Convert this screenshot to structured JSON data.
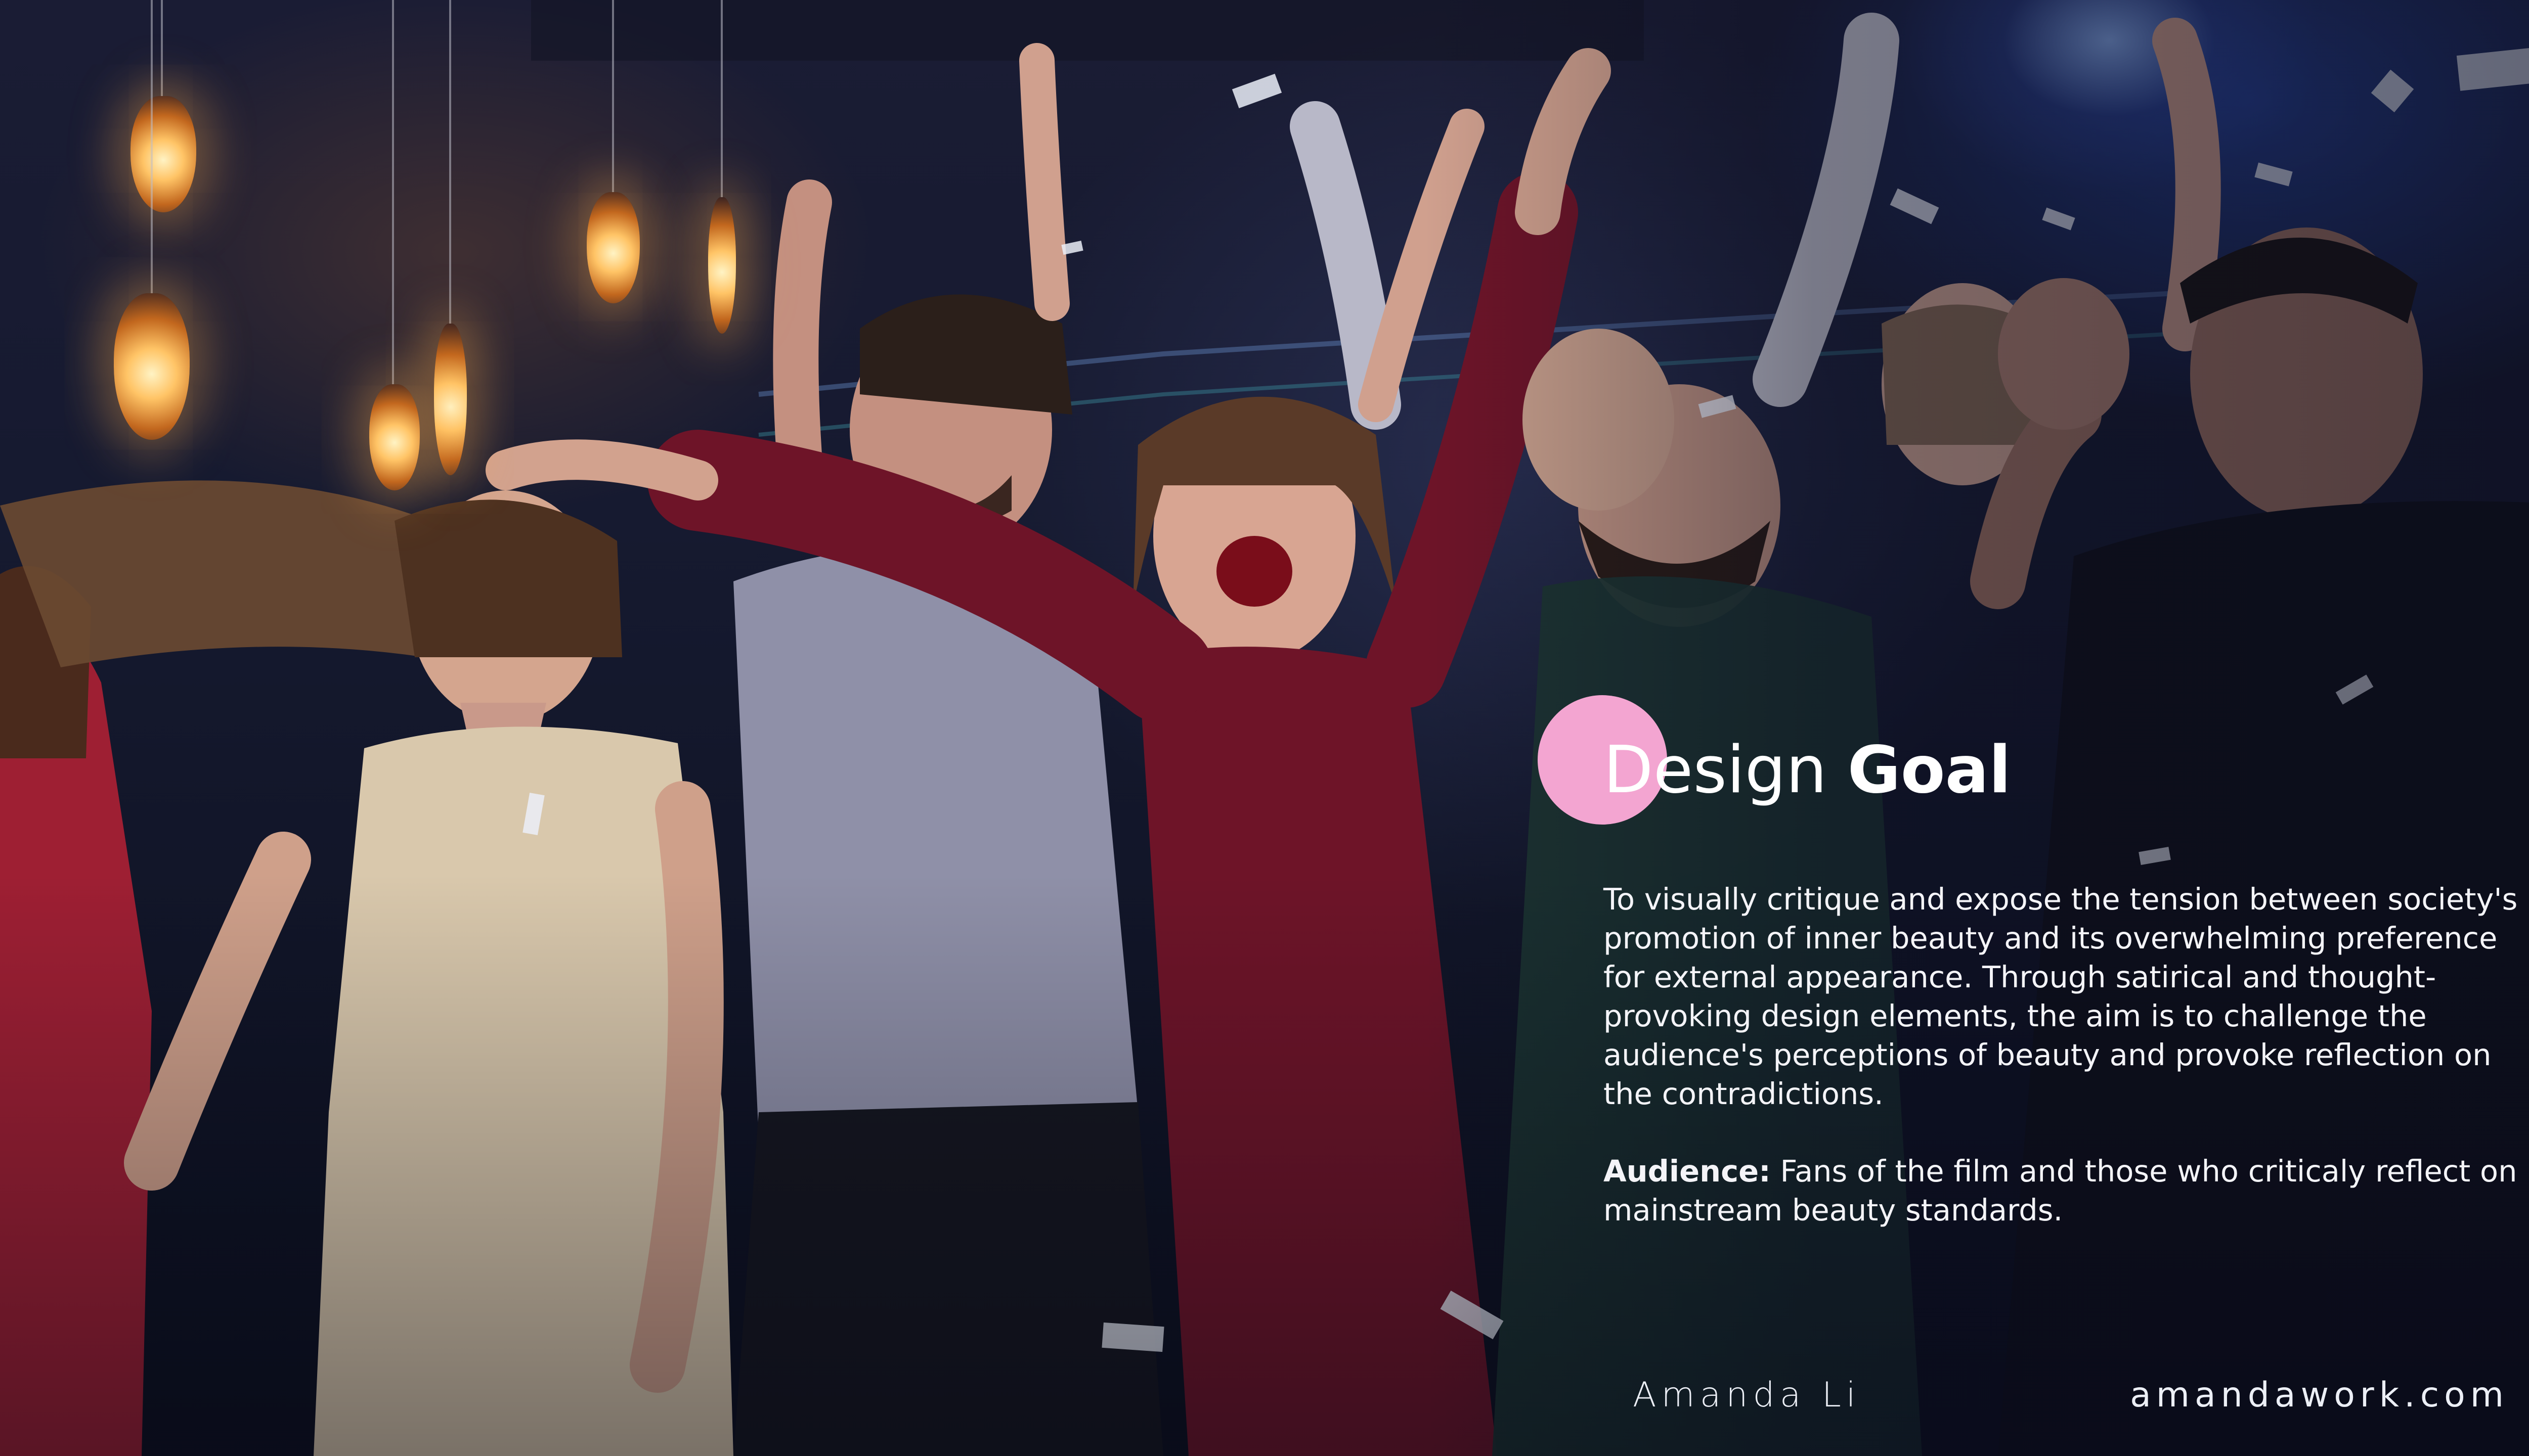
{
  "slide": {
    "photo_description_icon": "party-crowd-photo",
    "accent_color": "#f3a5d1",
    "heading": {
      "regular": "Design ",
      "bold": "Goal"
    },
    "body": "To visually critique and expose the tension between society's promotion of inner beauty and its overwhelming preference for external appearance. Through satirical and thought-provoking design elements, the aim is to challenge the audience's perceptions of beauty and provoke reflection on the contradictions.",
    "audience": {
      "label": "Audience:",
      "text": " Fans of the film and those who criticaly reflect on mainstream beauty standards."
    },
    "footer": {
      "name": "Amanda Li",
      "site": "amandawork.com"
    }
  }
}
